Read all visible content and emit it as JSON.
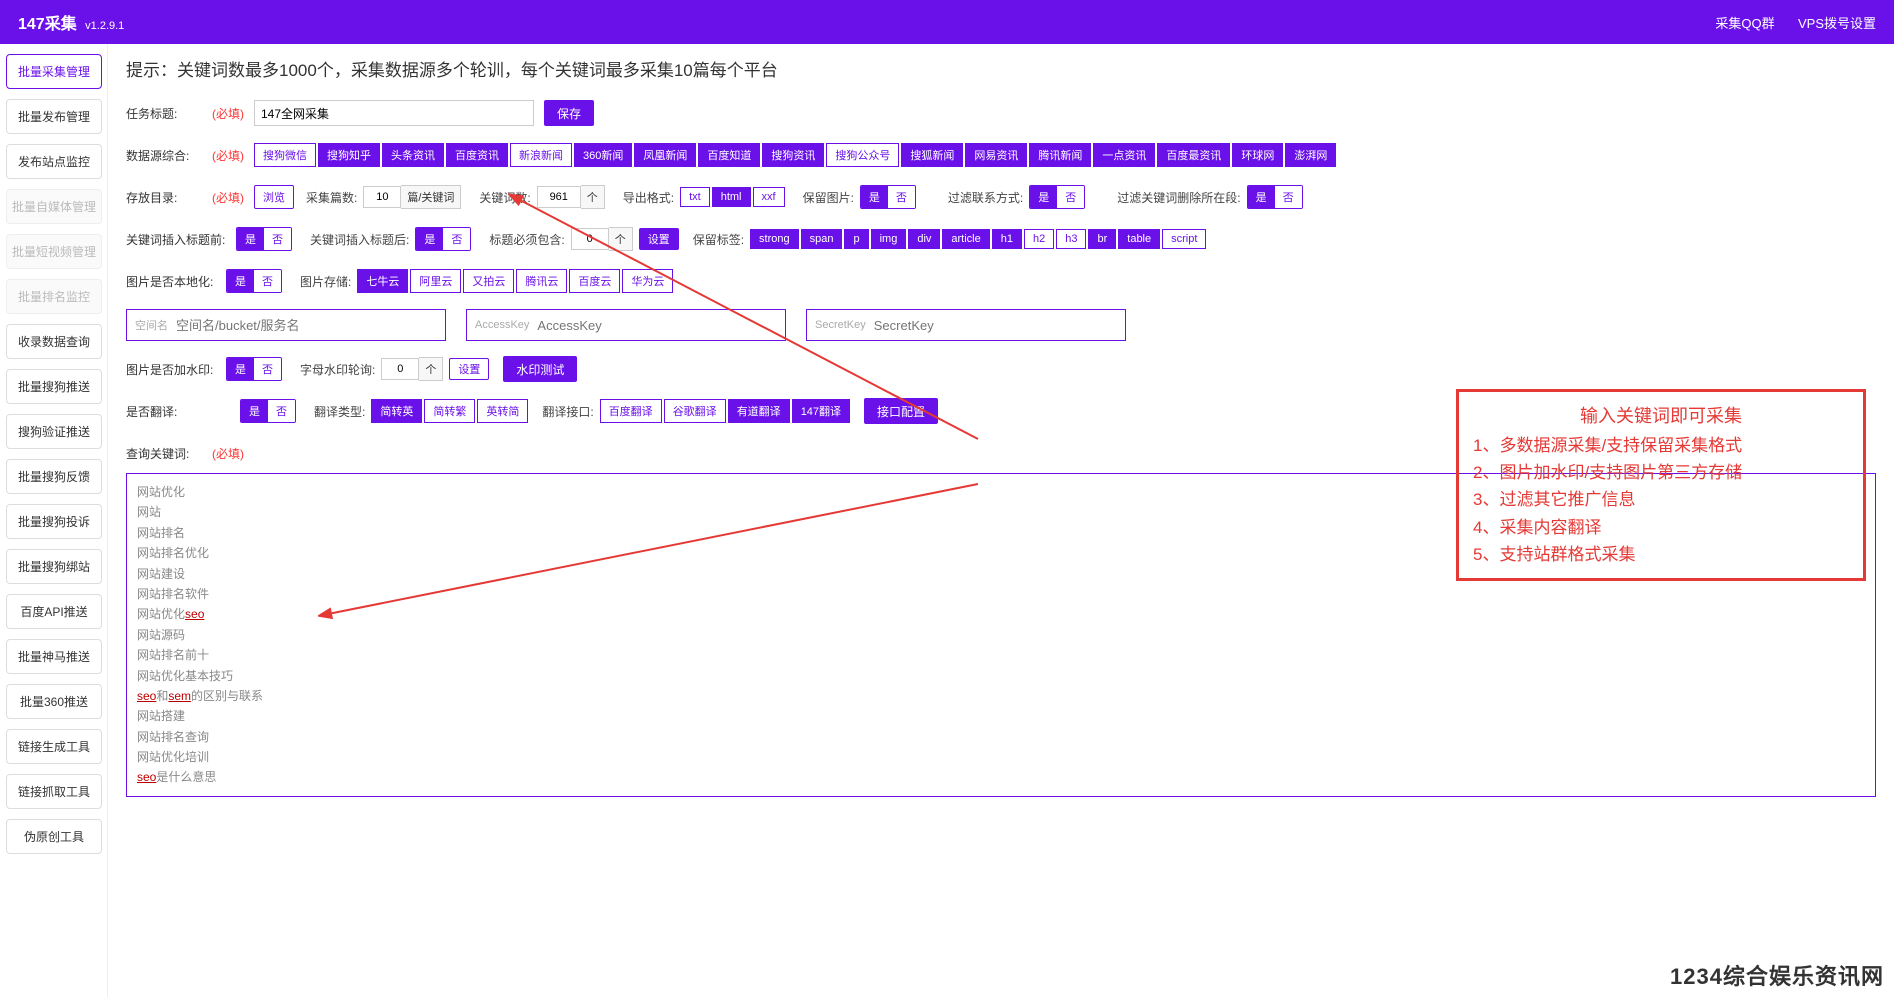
{
  "header": {
    "brand": "147采集",
    "version": "v1.2.9.1",
    "link_qq": "采集QQ群",
    "link_vps": "VPS拨号设置"
  },
  "sidebar": [
    {
      "label": "批量采集管理",
      "state": "active"
    },
    {
      "label": "批量发布管理",
      "state": ""
    },
    {
      "label": "发布站点监控",
      "state": ""
    },
    {
      "label": "批量自媒体管理",
      "state": "disabled"
    },
    {
      "label": "批量短视频管理",
      "state": "disabled"
    },
    {
      "label": "批量排名监控",
      "state": "disabled"
    },
    {
      "label": "收录数据查询",
      "state": ""
    },
    {
      "label": "批量搜狗推送",
      "state": ""
    },
    {
      "label": "搜狗验证推送",
      "state": ""
    },
    {
      "label": "批量搜狗反馈",
      "state": ""
    },
    {
      "label": "批量搜狗投诉",
      "state": ""
    },
    {
      "label": "批量搜狗绑站",
      "state": ""
    },
    {
      "label": "百度API推送",
      "state": ""
    },
    {
      "label": "批量神马推送",
      "state": ""
    },
    {
      "label": "批量360推送",
      "state": ""
    },
    {
      "label": "链接生成工具",
      "state": ""
    },
    {
      "label": "链接抓取工具",
      "state": ""
    },
    {
      "label": "伪原创工具",
      "state": ""
    }
  ],
  "tip": "提示：关键词数最多1000个，采集数据源多个轮训，每个关键词最多采集10篇每个平台",
  "labels": {
    "task_title": "任务标题:",
    "req": "(必填)",
    "save": "保存",
    "source": "数据源综合:",
    "dir": "存放目录:",
    "browse": "浏览",
    "count": "采集篇数:",
    "count_unit": "篇/关键词",
    "kwcount": "关键词数:",
    "kwcount_val": "961",
    "kwcount_unit": "个",
    "export": "导出格式:",
    "keepimg": "保留图片:",
    "filtercontact": "过滤联系方式:",
    "filterkw": "过滤关键词删除所在段:",
    "insert_before": "关键词插入标题前:",
    "insert_after": "关键词插入标题后:",
    "title_must": "标题必须包含:",
    "title_must_unit": "个",
    "title_must_btn": "设置",
    "keeptag": "保留标签:",
    "img_local": "图片是否本地化:",
    "img_store": "图片存储:",
    "space_ph": "空间名",
    "space_hint": "空间名/bucket/服务名",
    "ak_ph": "AccessKey",
    "ak_hint": "AccessKey",
    "sk_ph": "SecretKey",
    "sk_hint": "SecretKey",
    "watermark": "图片是否加水印:",
    "rotation": "字母水印轮询:",
    "rot_unit": "个",
    "rot_set": "设置",
    "wm_test": "水印测试",
    "translate": "是否翻译:",
    "trans_type": "翻译类型:",
    "trans_api": "翻译接口:",
    "api_cfg": "接口配置",
    "query_kw": "查询关键词:"
  },
  "task_title_value": "147全网采集",
  "sources": [
    {
      "t": "搜狗微信",
      "on": 0
    },
    {
      "t": "搜狗知乎",
      "on": 1
    },
    {
      "t": "头条资讯",
      "on": 1
    },
    {
      "t": "百度资讯",
      "on": 1
    },
    {
      "t": "新浪新闻",
      "on": 0
    },
    {
      "t": "360新闻",
      "on": 1
    },
    {
      "t": "凤凰新闻",
      "on": 1
    },
    {
      "t": "百度知道",
      "on": 1
    },
    {
      "t": "搜狗资讯",
      "on": 1
    },
    {
      "t": "搜狗公众号",
      "on": 0
    },
    {
      "t": "搜狐新闻",
      "on": 1
    },
    {
      "t": "网易资讯",
      "on": 1
    },
    {
      "t": "腾讯新闻",
      "on": 1
    },
    {
      "t": "一点资讯",
      "on": 1
    },
    {
      "t": "百度最资讯",
      "on": 1
    },
    {
      "t": "环球网",
      "on": 1
    },
    {
      "t": "澎湃网",
      "on": 1
    }
  ],
  "count_val": "10",
  "export_fmt": [
    {
      "t": "txt",
      "on": 0
    },
    {
      "t": "html",
      "on": 1
    },
    {
      "t": "xxf",
      "on": 0
    }
  ],
  "yes": "是",
  "no": "否",
  "toggles": {
    "keepimg": "是",
    "filtercontact": "是",
    "filterkw": "是",
    "insert_before": "是",
    "insert_after": "是",
    "img_local": "是",
    "watermark": "是",
    "translate": "是"
  },
  "title_must_val": "0",
  "keep_tags": [
    {
      "t": "strong",
      "on": 1
    },
    {
      "t": "span",
      "on": 1
    },
    {
      "t": "p",
      "on": 1
    },
    {
      "t": "img",
      "on": 1
    },
    {
      "t": "div",
      "on": 1
    },
    {
      "t": "article",
      "on": 1
    },
    {
      "t": "h1",
      "on": 1
    },
    {
      "t": "h2",
      "on": 0
    },
    {
      "t": "h3",
      "on": 0
    },
    {
      "t": "br",
      "on": 1
    },
    {
      "t": "table",
      "on": 1
    },
    {
      "t": "script",
      "on": 0
    }
  ],
  "img_stores": [
    {
      "t": "七牛云",
      "on": 1
    },
    {
      "t": "阿里云",
      "on": 0
    },
    {
      "t": "又拍云",
      "on": 0
    },
    {
      "t": "腾讯云",
      "on": 0
    },
    {
      "t": "百度云",
      "on": 0
    },
    {
      "t": "华为云",
      "on": 0
    }
  ],
  "rot_val": "0",
  "trans_types": [
    {
      "t": "简转英",
      "on": 1
    },
    {
      "t": "简转繁",
      "on": 0
    },
    {
      "t": "英转简",
      "on": 0
    }
  ],
  "trans_apis": [
    {
      "t": "百度翻译",
      "on": 0
    },
    {
      "t": "谷歌翻译",
      "on": 0
    },
    {
      "t": "有道翻译",
      "on": 1
    },
    {
      "t": "147翻译",
      "on": 1
    }
  ],
  "keywords_text": "网站优化\n网站\n网站排名\n网站排名优化\n网站建设\n网站排名软件\n网站优化seo\n网站源码\n网站排名前十\n网站优化基本技巧\nseo和sem的区别与联系\n网站搭建\n网站排名查询\n网站优化培训\nseo是什么意思",
  "overlay": {
    "title": "输入关键词即可采集",
    "l1": "1、多数据源采集/支持保留采集格式",
    "l2": "2、图片加水印/支持图片第三方存储",
    "l3": "3、过滤其它推广信息",
    "l4": "4、采集内容翻译",
    "l5": "5、支持站群格式采集"
  },
  "watermark_text": "1234综合娱乐资讯网"
}
